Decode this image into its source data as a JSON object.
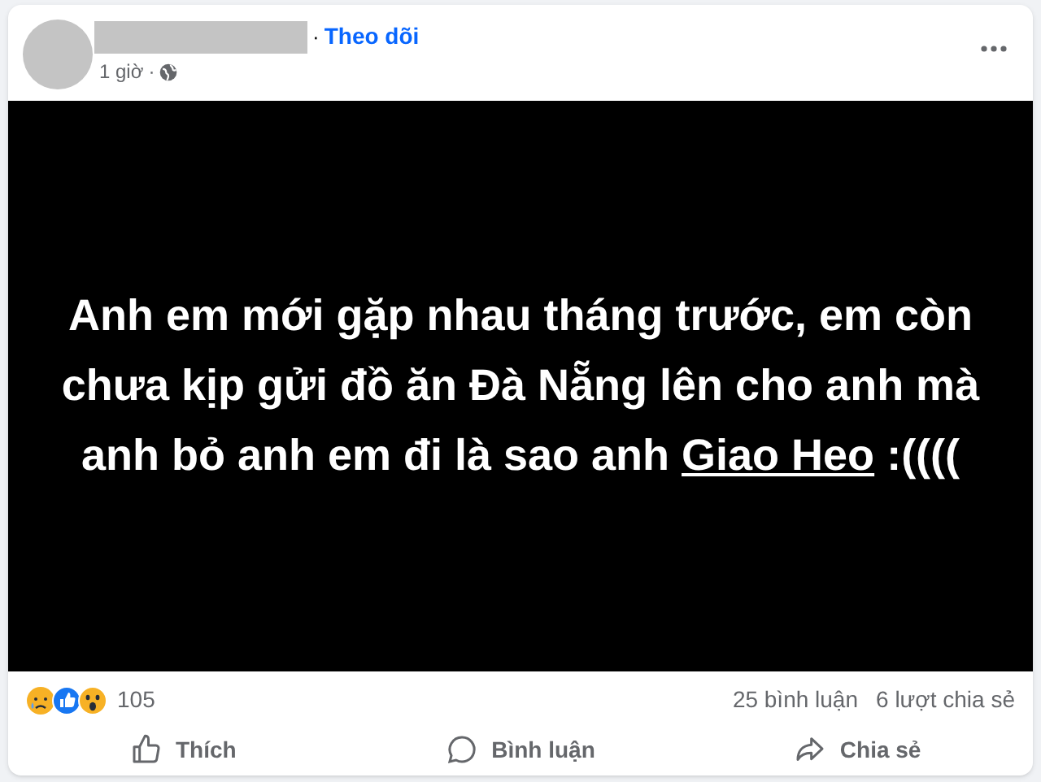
{
  "header": {
    "follow": "Theo dõi",
    "separator": "·",
    "time": "1 giờ",
    "time_separator": "·"
  },
  "post_image": {
    "text_before": "Anh em mới gặp nhau tháng trước, em còn chưa kịp gửi đồ ăn Đà Nẵng lên cho anh mà anh bỏ anh em đi là sao anh",
    "link": "Giao Heo",
    "text_after": ":(((("
  },
  "stats": {
    "reactions_count": "105",
    "comments": "25 bình luận",
    "shares": "6 lượt chia sẻ"
  },
  "actions": [
    {
      "kind": "like",
      "label": "Thích"
    },
    {
      "kind": "comment",
      "label": "Bình luận"
    },
    {
      "kind": "share",
      "label": "Chia sẻ"
    }
  ]
}
